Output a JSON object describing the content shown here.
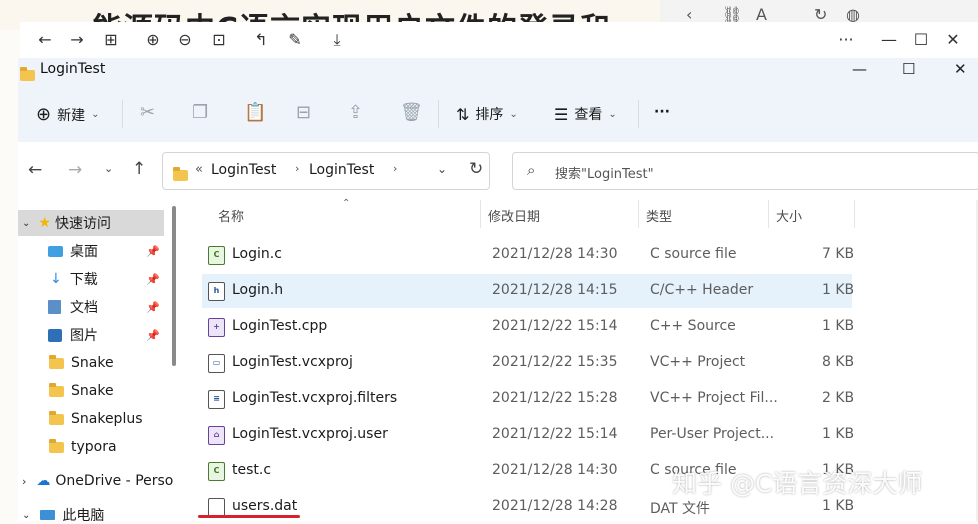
{
  "background": {
    "heading": "能源码中C语言实现用户文件的登录和",
    "browser_icons": [
      "back-icon",
      "link-icon",
      "text-size-icon",
      "refresh-icon",
      "globe-icon"
    ]
  },
  "outer_toolbar": {
    "icons": [
      "back-icon",
      "forward-icon",
      "grid-icon",
      "zoom-in-icon",
      "zoom-out-icon",
      "fit-icon",
      "rotate-icon",
      "edit-icon",
      "save-icon"
    ],
    "more_label": "···"
  },
  "window": {
    "title": "LoginTest"
  },
  "command_bar": {
    "new_label": "新建",
    "sort_label": "排序",
    "view_label": "查看",
    "more_label": "···"
  },
  "address": {
    "overflow": "«",
    "crumbs": [
      "LoginTest",
      "LoginTest"
    ],
    "search_placeholder": "搜索\"LoginTest\""
  },
  "sidebar": {
    "items": [
      {
        "label": "快速访问",
        "icon": "star-icon",
        "pinned": false
      },
      {
        "label": "桌面",
        "icon": "desktop-icon",
        "pinned": true
      },
      {
        "label": "下载",
        "icon": "download-icon",
        "pinned": true
      },
      {
        "label": "文档",
        "icon": "document-icon",
        "pinned": true
      },
      {
        "label": "图片",
        "icon": "pictures-icon",
        "pinned": true
      },
      {
        "label": "Snake",
        "icon": "folder-icon",
        "pinned": false
      },
      {
        "label": "Snake",
        "icon": "folder-icon",
        "pinned": false
      },
      {
        "label": "Snakeplus",
        "icon": "folder-icon",
        "pinned": false
      },
      {
        "label": "typora",
        "icon": "folder-icon",
        "pinned": false
      },
      {
        "label": "OneDrive - Perso",
        "icon": "cloud-icon",
        "pinned": false
      },
      {
        "label": "此电脑",
        "icon": "pc-icon",
        "pinned": false
      }
    ]
  },
  "file_list": {
    "columns": {
      "name": "名称",
      "date": "修改日期",
      "type": "类型",
      "size": "大小"
    },
    "rows": [
      {
        "name": "Login.c",
        "date": "2021/12/28 14:30",
        "type": "C source file",
        "size": "7 KB"
      },
      {
        "name": "Login.h",
        "date": "2021/12/28 14:15",
        "type": "C/C++ Header",
        "size": "1 KB"
      },
      {
        "name": "LoginTest.cpp",
        "date": "2021/12/22 15:14",
        "type": "C++ Source",
        "size": "1 KB"
      },
      {
        "name": "LoginTest.vcxproj",
        "date": "2021/12/22 15:35",
        "type": "VC++ Project",
        "size": "8 KB"
      },
      {
        "name": "LoginTest.vcxproj.filters",
        "date": "2021/12/22 15:28",
        "type": "VC++ Project Fil...",
        "size": "2 KB"
      },
      {
        "name": "LoginTest.vcxproj.user",
        "date": "2021/12/22 15:14",
        "type": "Per-User Project...",
        "size": "1 KB"
      },
      {
        "name": "test.c",
        "date": "2021/12/28 14:30",
        "type": "C source file",
        "size": "1 KB"
      },
      {
        "name": "users.dat",
        "date": "2021/12/28 14:28",
        "type": "DAT 文件",
        "size": "1 KB"
      }
    ]
  },
  "watermark": "知乎 @C语言资深大师"
}
